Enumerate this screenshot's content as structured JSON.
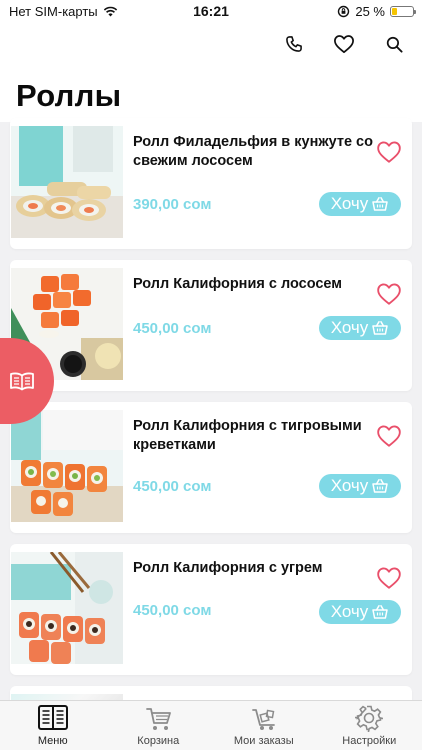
{
  "status_bar": {
    "carrier": "Нет SIM-карты",
    "time": "16:21",
    "battery": "25 %",
    "battery_level": 0.25
  },
  "header": {
    "title": "Роллы",
    "icons": [
      "phone-icon",
      "heart-icon",
      "search-icon"
    ]
  },
  "products": [
    {
      "name": "Ролл Филадельфия в кунжуте со свежим лососем",
      "price": "390,00 сом",
      "button": "Хочу"
    },
    {
      "name": "Ролл Калифорния с лососем",
      "price": "450,00 сом",
      "button": "Хочу"
    },
    {
      "name": "Ролл Калифорния с тигровыми креветками",
      "price": "450,00 сом",
      "button": "Хочу"
    },
    {
      "name": "Ролл Калифорния с угрем",
      "price": "450,00 сом",
      "button": "Хочу"
    }
  ],
  "tabs": [
    {
      "label": "Меню",
      "icon": "menu-book-icon",
      "active": true
    },
    {
      "label": "Корзина",
      "icon": "cart-icon",
      "active": false
    },
    {
      "label": "Мои заказы",
      "icon": "delivery-cart-icon",
      "active": false
    },
    {
      "label": "Настройки",
      "icon": "gear-icon",
      "active": false
    }
  ],
  "colors": {
    "accent": "#7fd9e6",
    "heart": "#e94f6a",
    "float_menu": "#ec5d64"
  }
}
